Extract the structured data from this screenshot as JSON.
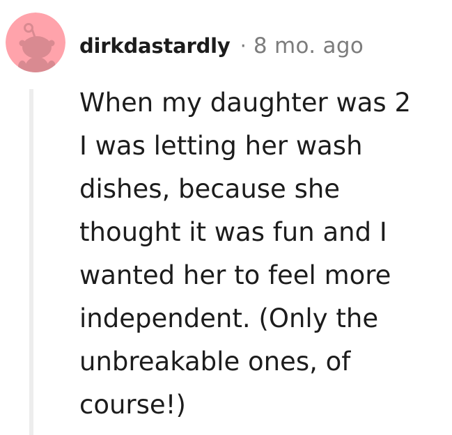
{
  "comment": {
    "author": "dirkdastardly",
    "separator": "·",
    "timestamp": "8 mo. ago",
    "body_lines": [
      "When my daughter was 2",
      "I was letting her wash",
      "dishes, because she",
      "thought it was fun and I",
      "wanted her to feel more",
      "independent. (Only the",
      "unbreakable ones, of",
      "course!)"
    ],
    "avatar": {
      "icon": "reddit-snoo-avatar-icon",
      "background_color": "#ffa3ab",
      "figure_color": "#d98a91"
    }
  }
}
